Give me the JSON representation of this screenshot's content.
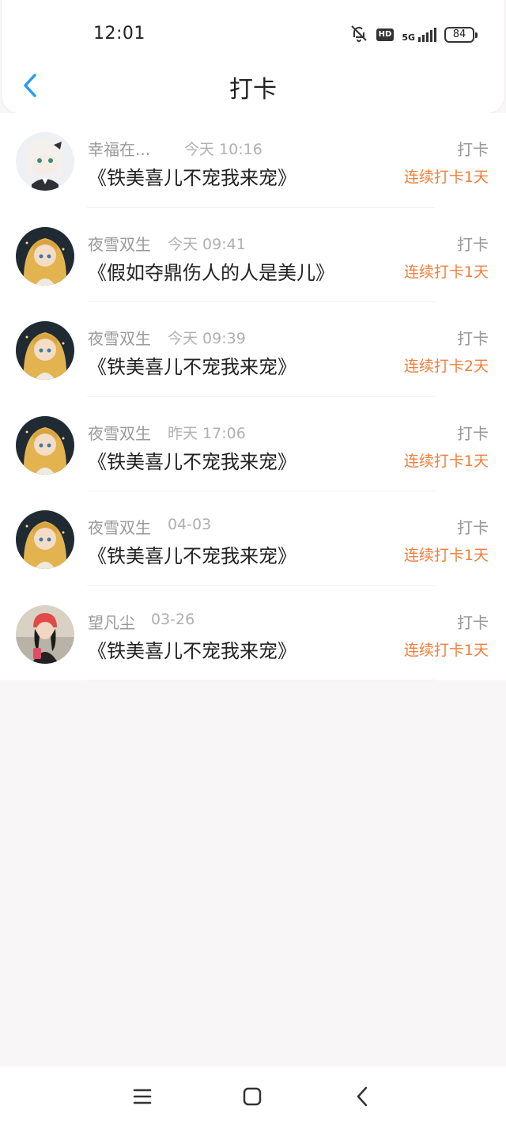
{
  "status_bar": {
    "time": "12:01",
    "icons": [
      "bell-muted-icon",
      "hd-icon",
      "signal-5g-icon",
      "battery-icon"
    ],
    "hd": "HD",
    "network": "5G",
    "battery": "84"
  },
  "header": {
    "back_icon": "chevron-left-icon",
    "title": "打卡"
  },
  "colors": {
    "accent_blue": "#2b9af3",
    "streak_orange": "#f07f3c",
    "muted_text": "#999999",
    "page_bg": "#f8f6f7"
  },
  "checkins": [
    {
      "user": "幸福在...",
      "time": "今天 10:16",
      "title": "《铁美喜儿不宠我来宠》",
      "action": "打卡",
      "streak": "连续打卡1天"
    },
    {
      "user": "夜雪双生",
      "time": "今天 09:41",
      "title": "《假如夺鼎伤人的人是美儿》",
      "action": "打卡",
      "streak": "连续打卡1天"
    },
    {
      "user": "夜雪双生",
      "time": "今天 09:39",
      "title": "《铁美喜儿不宠我来宠》",
      "action": "打卡",
      "streak": "连续打卡2天"
    },
    {
      "user": "夜雪双生",
      "time": "昨天 17:06",
      "title": "《铁美喜儿不宠我来宠》",
      "action": "打卡",
      "streak": "连续打卡1天"
    },
    {
      "user": "夜雪双生",
      "time": "04-03",
      "title": "《铁美喜儿不宠我来宠》",
      "action": "打卡",
      "streak": "连续打卡1天"
    },
    {
      "user": "望凡尘",
      "time": "03-26",
      "title": "《铁美喜儿不宠我来宠》",
      "action": "打卡",
      "streak": "连续打卡1天"
    }
  ],
  "nav_bar": {
    "icons": [
      "menu-icon",
      "home-square-icon",
      "back-triangle-icon"
    ]
  }
}
